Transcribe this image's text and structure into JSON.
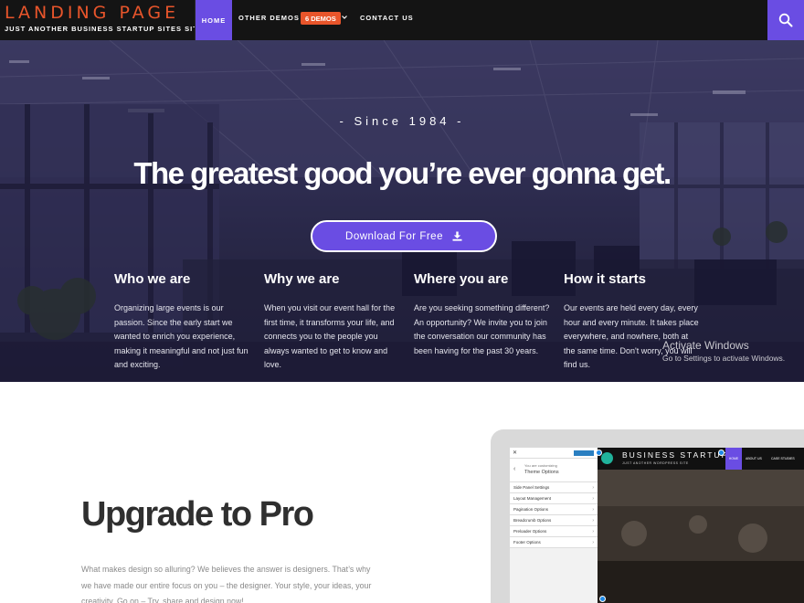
{
  "brand": {
    "title": "LANDING PAGE",
    "tagline": "JUST ANOTHER BUSINESS STARTUP SITES SITE"
  },
  "nav": {
    "home": "HOME",
    "other_demos": "OTHER DEMOS",
    "demos_badge": "6 DEMOS",
    "contact": "CONTACT US",
    "search_icon": "search-icon"
  },
  "hero": {
    "since": "- Since 1984 -",
    "headline": "The greatest good you’re ever gonna get.",
    "cta": "Download For Free",
    "columns": [
      {
        "title": "Who we are",
        "text": "Organizing large events is our passion. Since the early start we wanted to enrich you experience, making it meaningful and not just fun and exciting."
      },
      {
        "title": "Why we are",
        "text": "When you visit our event hall for the first time, it transforms your life, and connects you to the people you always wanted to get to know and love."
      },
      {
        "title": "Where you are",
        "text": "Are you seeking something different? An opportunity? We invite you to join the conversation our community has been having for the past 30 years."
      },
      {
        "title": "How it starts",
        "text": "Our events are held every day, every hour and every minute. It takes place everywhere, and nowhere, both at the same time. Don't worry, you will find us."
      }
    ]
  },
  "watermark": {
    "line1": "Activate Windows",
    "line2": "Go to Settings to activate Windows."
  },
  "pro": {
    "title": "Upgrade to Pro",
    "text": "What makes design so alluring? We believes the answer is designers. That’s why we have made our entire focus on you – the designer. Your style, your ideas, your creativity. Go on – Try, share and design now!"
  },
  "mockup": {
    "panel": {
      "sub": "You are customizing",
      "heading": "Theme Options",
      "items": [
        "Side Panel Settings",
        "Layout Management",
        "Pagination Options",
        "Breadcrumb Options",
        "Preloader Options",
        "Footer Options"
      ]
    },
    "site": {
      "title": "BUSINESS STARTUP",
      "tagline": "JUST ANOTHER WORDPRESS SITE",
      "home": "HOME",
      "about": "ABOUT US",
      "case": "CASE STUDIES"
    }
  },
  "colors": {
    "accent": "#6a4de3",
    "brand": "#e8552b",
    "nav_bg": "#141414"
  }
}
